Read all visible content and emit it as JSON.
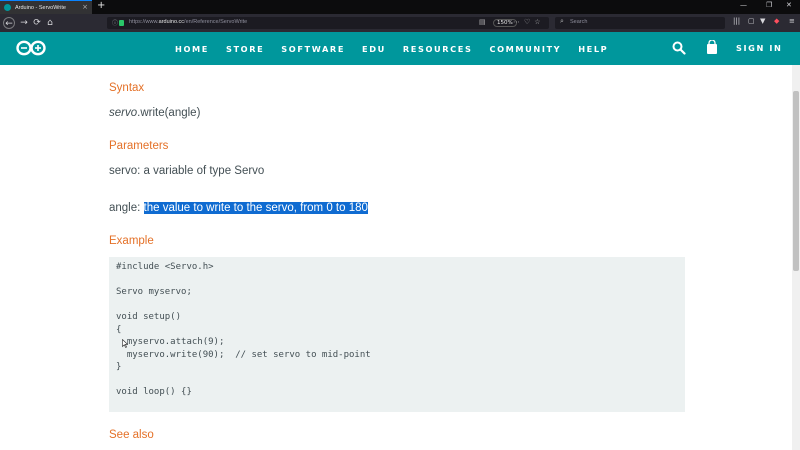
{
  "browser": {
    "tab_title": "Arduino - ServoWrite",
    "tab_close": "×",
    "new_tab": "+",
    "url_prefix": "https://www.",
    "url_domain": "arduino.cc",
    "url_path": "/en/Reference/ServoWrite",
    "zoom": "150%",
    "search_placeholder": "Search",
    "window_controls": [
      "—",
      "❐",
      "✕"
    ]
  },
  "site": {
    "menu": [
      "HOME",
      "STORE",
      "SOFTWARE",
      "EDU",
      "RESOURCES",
      "COMMUNITY",
      "HELP"
    ],
    "signin": "SIGN IN",
    "brand_color": "#00979c"
  },
  "content": {
    "syntax_heading": "Syntax",
    "syntax_italic": "servo",
    "syntax_rest": ".write(angle)",
    "parameters_heading": "Parameters",
    "param_servo": "servo: a variable of type Servo",
    "param_angle_label": "angle: ",
    "param_angle_selected": "the value to write to the servo, from 0 to 180",
    "example_heading": "Example",
    "code_lines": [
      "#include <Servo.h>",
      "",
      "Servo myservo;",
      "",
      "void setup()",
      "{",
      "  myservo.attach(9);",
      "  myservo.write(90);  // set servo to mid-point",
      "}",
      "",
      "void loop() {}"
    ],
    "see_also_heading": "See also"
  },
  "colors": {
    "heading": "#e47128",
    "text": "#434f54",
    "selection": "#0f6bd1",
    "code_bg": "#ecf1f1"
  }
}
